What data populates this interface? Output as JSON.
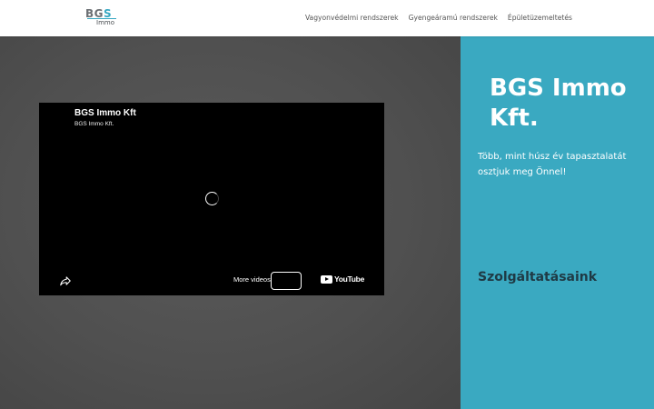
{
  "header": {
    "logo": {
      "text_top_a": "BG",
      "text_top_b": "S",
      "text_bottom": "Immo"
    },
    "nav": [
      {
        "label": "Vagyonvédelmi rendszerek"
      },
      {
        "label": "Gyengeáramú rendszerek"
      },
      {
        "label": "Épületüzemeltetés"
      }
    ]
  },
  "video": {
    "title": "BGS Immo Kft",
    "channel": "BGS Immo Kft.",
    "more_videos": "More videos",
    "brand": "YouTube",
    "icons": {
      "share": "share-icon",
      "spinner": "loading-spinner-icon",
      "logo": "youtube-logo-icon"
    }
  },
  "hero": {
    "company": "BGS Immo Kft.",
    "tagline": "Több, mint húsz év tapasztalatát osztjuk meg Önnel!",
    "services_heading": "Szolgáltatásaink"
  },
  "colors": {
    "accent": "#3aa9c1",
    "dark_panel": "#505050",
    "heading_dark": "#1f3a45"
  }
}
